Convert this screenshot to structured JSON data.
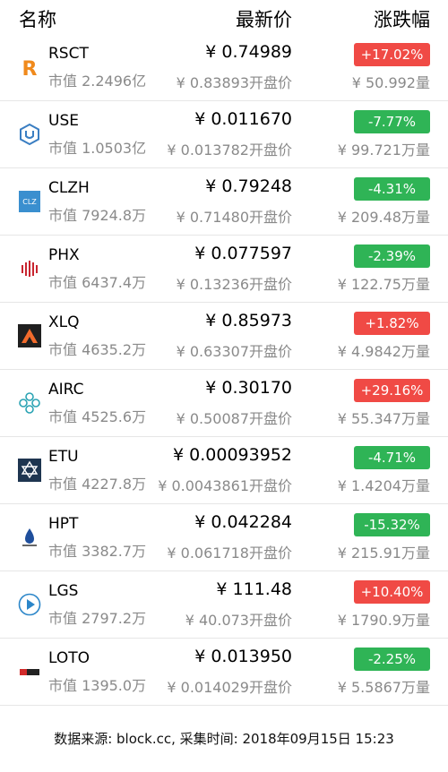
{
  "header": {
    "name": "名称",
    "price": "最新价",
    "change": "涨跌幅"
  },
  "rows": [
    {
      "symbol": "RSCT",
      "mcap": "市值 2.2496亿",
      "price": "¥ 0.74989",
      "open": "¥ 0.83893开盘价",
      "change": "+17.02%",
      "direction": "up",
      "volume": "¥ 50.992量",
      "logo": "rsct-logo-icon"
    },
    {
      "symbol": "USE",
      "mcap": "市值 1.0503亿",
      "price": "¥ 0.011670",
      "open": "¥ 0.013782开盘价",
      "change": "-7.77%",
      "direction": "down",
      "volume": "¥ 99.721万量",
      "logo": "use-logo-icon"
    },
    {
      "symbol": "CLZH",
      "mcap": "市值 7924.8万",
      "price": "¥ 0.79248",
      "open": "¥ 0.71480开盘价",
      "change": "-4.31%",
      "direction": "down",
      "volume": "¥ 209.48万量",
      "logo": "clzh-logo-icon",
      "logo_text": "CLZ"
    },
    {
      "symbol": "PHX",
      "mcap": "市值 6437.4万",
      "price": "¥ 0.077597",
      "open": "¥ 0.13236开盘价",
      "change": "-2.39%",
      "direction": "down",
      "volume": "¥ 122.75万量",
      "logo": "phx-logo-icon"
    },
    {
      "symbol": "XLQ",
      "mcap": "市值 4635.2万",
      "price": "¥ 0.85973",
      "open": "¥ 0.63307开盘价",
      "change": "+1.82%",
      "direction": "up",
      "volume": "¥ 4.9842万量",
      "logo": "xlq-logo-icon"
    },
    {
      "symbol": "AIRC",
      "mcap": "市值 4525.6万",
      "price": "¥ 0.30170",
      "open": "¥ 0.50087开盘价",
      "change": "+29.16%",
      "direction": "up",
      "volume": "¥ 55.347万量",
      "logo": "airc-logo-icon"
    },
    {
      "symbol": "ETU",
      "mcap": "市值 4227.8万",
      "price": "¥ 0.00093952",
      "open": "¥ 0.0043861开盘价",
      "change": "-4.71%",
      "direction": "down",
      "volume": "¥ 1.4204万量",
      "logo": "etu-logo-icon"
    },
    {
      "symbol": "HPT",
      "mcap": "市值 3382.7万",
      "price": "¥ 0.042284",
      "open": "¥ 0.061718开盘价",
      "change": "-15.32%",
      "direction": "down",
      "volume": "¥ 215.91万量",
      "logo": "hpt-logo-icon"
    },
    {
      "symbol": "LGS",
      "mcap": "市值 2797.2万",
      "price": "¥ 111.48",
      "open": "¥ 40.073开盘价",
      "change": "+10.40%",
      "direction": "up",
      "volume": "¥ 1790.9万量",
      "logo": "lgs-logo-icon"
    },
    {
      "symbol": "LOTO",
      "mcap": "市值 1395.0万",
      "price": "¥ 0.013950",
      "open": "¥ 0.014029开盘价",
      "change": "-2.25%",
      "direction": "down",
      "volume": "¥ 5.5867万量",
      "logo": "loto-logo-icon"
    }
  ],
  "footer": "数据来源: block.cc, 采集时间: 2018年09月15日 15:23",
  "colors": {
    "up": "#f04a45",
    "down": "#2fb456",
    "muted": "#8a8a8a"
  }
}
